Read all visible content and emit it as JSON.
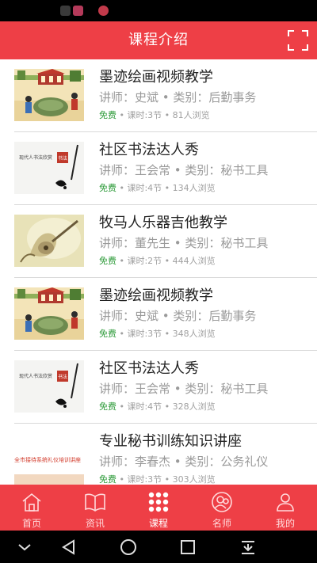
{
  "colors": {
    "accent": "#ee3f46",
    "free": "#2e9b3a",
    "meta": "#9a9a9a"
  },
  "header": {
    "title": "课程介绍",
    "action_icon": "scan-icon"
  },
  "courses": [
    {
      "title": "墨迹绘画视频教学",
      "meta": "讲师：史斌 • 类别：后勤事务",
      "free": "免费",
      "stats": " • 课时:3节 • 81人浏览",
      "thumb": "painting"
    },
    {
      "title": "社区书法达人秀",
      "meta": "讲师：王会常 • 类别：秘书工具",
      "free": "免费",
      "stats": " • 课时:4节 • 134人浏览",
      "thumb": "calligraphy"
    },
    {
      "title": "牧马人乐器吉他教学",
      "meta": "讲师：董先生 • 类别：秘书工具",
      "free": "免费",
      "stats": " • 课时:2节 • 444人浏览",
      "thumb": "guitar"
    },
    {
      "title": "墨迹绘画视频教学",
      "meta": "讲师：史斌 • 类别：后勤事务",
      "free": "免费",
      "stats": " • 课时:3节 • 348人浏览",
      "thumb": "painting"
    },
    {
      "title": "社区书法达人秀",
      "meta": "讲师：王会常 • 类别：秘书工具",
      "free": "免费",
      "stats": " • 课时:4节 • 328人浏览",
      "thumb": "calligraphy"
    },
    {
      "title": "专业秘书训练知识讲座",
      "meta": "讲师：李春杰 • 类别：公务礼仪",
      "free": "免费",
      "stats": " • 课时:3节 • 303人浏览",
      "thumb": "lecture",
      "thumb_text": "全市接待系统礼仪培训讲座"
    }
  ],
  "calligraphy_thumb": {
    "caption": "现代人书法欣赏",
    "seal": "书法"
  },
  "tabs": [
    {
      "label": "首页",
      "icon": "home-icon",
      "active": false
    },
    {
      "label": "资讯",
      "icon": "book-icon",
      "active": false
    },
    {
      "label": "课程",
      "icon": "grid-icon",
      "active": true
    },
    {
      "label": "名师",
      "icon": "teacher-icon",
      "active": false
    },
    {
      "label": "我的",
      "icon": "profile-icon",
      "active": false
    }
  ],
  "system_nav": [
    "collapse-icon",
    "back-icon",
    "home-circle-icon",
    "recents-icon",
    "notification-pull-icon"
  ]
}
